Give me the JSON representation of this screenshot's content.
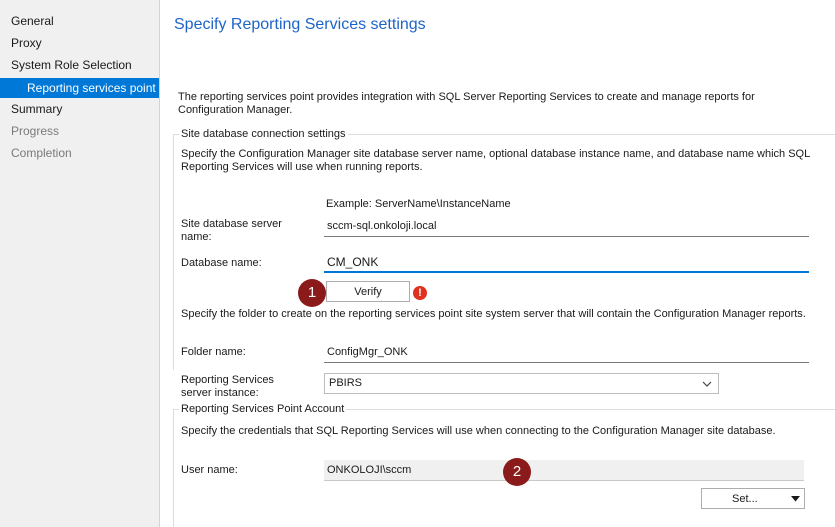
{
  "sidebar": {
    "items": [
      {
        "label": "General",
        "state": "normal"
      },
      {
        "label": "Proxy",
        "state": "normal"
      },
      {
        "label": "System Role Selection",
        "state": "normal"
      },
      {
        "label": "Reporting services point",
        "state": "active"
      },
      {
        "label": "Summary",
        "state": "normal"
      },
      {
        "label": "Progress",
        "state": "disabled"
      },
      {
        "label": "Completion",
        "state": "disabled"
      }
    ]
  },
  "page": {
    "title": "Specify Reporting Services settings",
    "intro": "The reporting services point provides integration with SQL Server Reporting Services to create and manage reports for Configuration Manager."
  },
  "site_db": {
    "group_title": "Site database connection settings",
    "description": "Specify the Configuration Manager site database server name, optional database instance name, and database name which SQL Reporting Services will use when running reports.",
    "example": "Example: ServerName\\InstanceName",
    "server_label": "Site database server name:",
    "server_value": "sccm-sql.onkoloji.local",
    "db_label": "Database name:",
    "db_value": "CM_ONK",
    "verify_label": "Verify",
    "folder_description": "Specify the folder to create on the reporting services point site system server that will contain the Configuration Manager reports.",
    "folder_label": "Folder name:",
    "folder_value": "ConfigMgr_ONK"
  },
  "instance": {
    "label": "Reporting Services server instance:",
    "value": "PBIRS"
  },
  "account": {
    "group_title": "Reporting Services Point Account",
    "description": "Specify the credentials that SQL Reporting Services will use when connecting to the Configuration Manager site database.",
    "user_label": "User name:",
    "user_value": "ONKOLOJI\\sccm",
    "set_label": "Set..."
  },
  "callouts": {
    "one": "1",
    "two": "2"
  },
  "icons": {
    "warning": "!"
  },
  "colors": {
    "accent": "#0078d7",
    "title": "#1e64c8",
    "callout": "#8b1a1a",
    "warning": "#e0301e"
  }
}
